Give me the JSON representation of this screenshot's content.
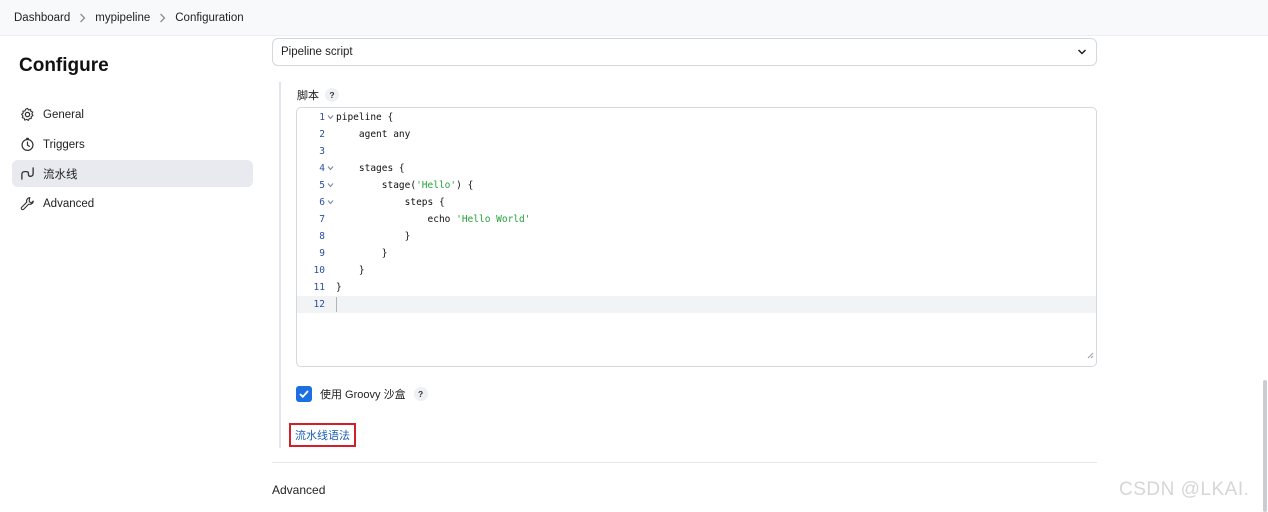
{
  "breadcrumb": {
    "items": [
      "Dashboard",
      "mypipeline",
      "Configuration"
    ]
  },
  "sidebar": {
    "title": "Configure",
    "items": [
      {
        "label": "General",
        "icon": "gear-icon"
      },
      {
        "label": "Triggers",
        "icon": "timer-icon"
      },
      {
        "label": "流水线",
        "icon": "pipeline-icon",
        "active": true
      },
      {
        "label": "Advanced",
        "icon": "wrench-icon"
      }
    ]
  },
  "definition": {
    "selected": "Pipeline script"
  },
  "script": {
    "label": "脚本",
    "help": "?",
    "lines": [
      {
        "num": "1",
        "fold": true,
        "code": "pipeline {"
      },
      {
        "num": "2",
        "code": "    agent any"
      },
      {
        "num": "3",
        "code": ""
      },
      {
        "num": "4",
        "fold": true,
        "code": "    stages {"
      },
      {
        "num": "5",
        "fold": true,
        "code": "        stage(",
        "str": "'Hello'",
        "after": ") {"
      },
      {
        "num": "6",
        "fold": true,
        "code": "            steps {"
      },
      {
        "num": "7",
        "code": "                echo ",
        "str": "'Hello World'",
        "after": ""
      },
      {
        "num": "8",
        "code": "            }"
      },
      {
        "num": "9",
        "code": "        }"
      },
      {
        "num": "10",
        "code": "    }"
      },
      {
        "num": "11",
        "code": "}"
      },
      {
        "num": "12",
        "code": "",
        "current": true
      }
    ]
  },
  "sandbox": {
    "label": "使用 Groovy 沙盒",
    "checked": true,
    "help": "?"
  },
  "syntax_link": "流水线语法",
  "advanced_section": "Advanced",
  "watermark": "CSDN @LKAI.",
  "colors": {
    "accent": "#1b6fe0",
    "highlight_box": "#d31f2a",
    "string": "#22a33a",
    "link": "#1a5fb4"
  }
}
